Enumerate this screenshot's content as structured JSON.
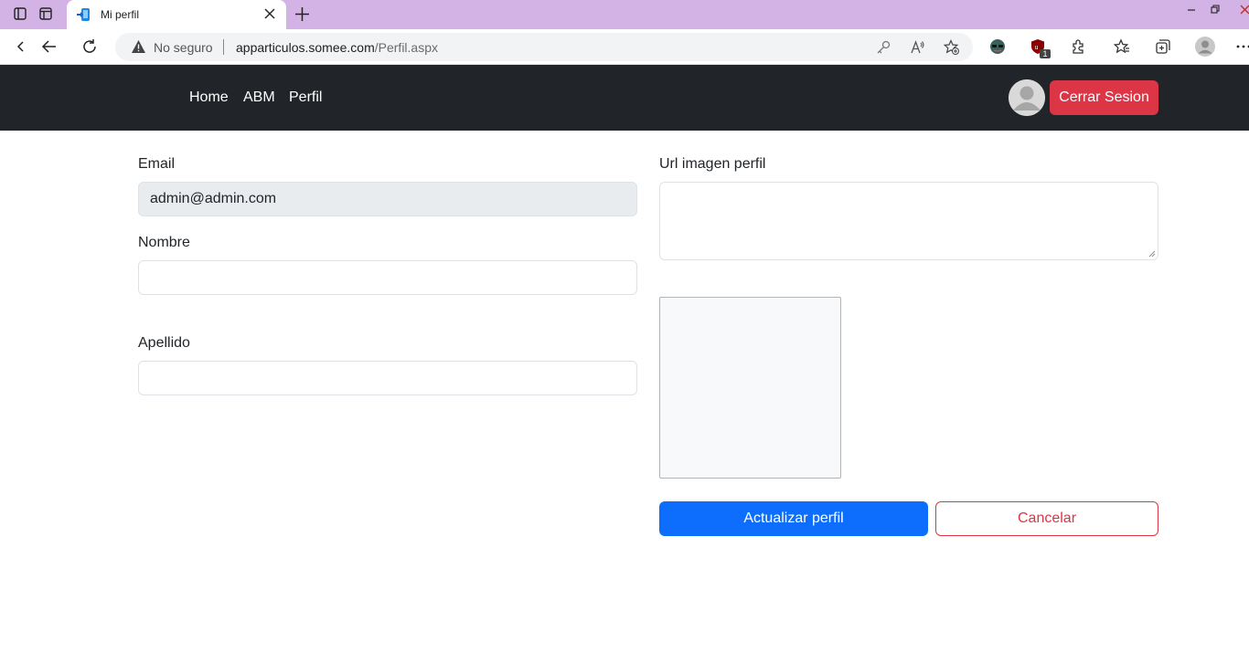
{
  "browser": {
    "tab_title": "Mi perfil",
    "security_label": "No seguro",
    "url_host": "apparticulos.somee.com",
    "url_path": "/Perfil.aspx",
    "extension_badge": "1"
  },
  "navbar": {
    "links": [
      "Home",
      "ABM",
      "Perfil"
    ],
    "logout_label": "Cerrar Sesion"
  },
  "form": {
    "email_label": "Email",
    "email_value": "admin@admin.com",
    "nombre_label": "Nombre",
    "nombre_value": "",
    "apellido_label": "Apellido",
    "apellido_value": "",
    "url_label": "Url imagen perfil",
    "url_value": "",
    "submit_label": "Actualizar perfil",
    "cancel_label": "Cancelar"
  },
  "colors": {
    "tabbar": "#d3b3e5",
    "navbar": "#212529",
    "danger": "#dc3545",
    "primary": "#0d6efd"
  }
}
